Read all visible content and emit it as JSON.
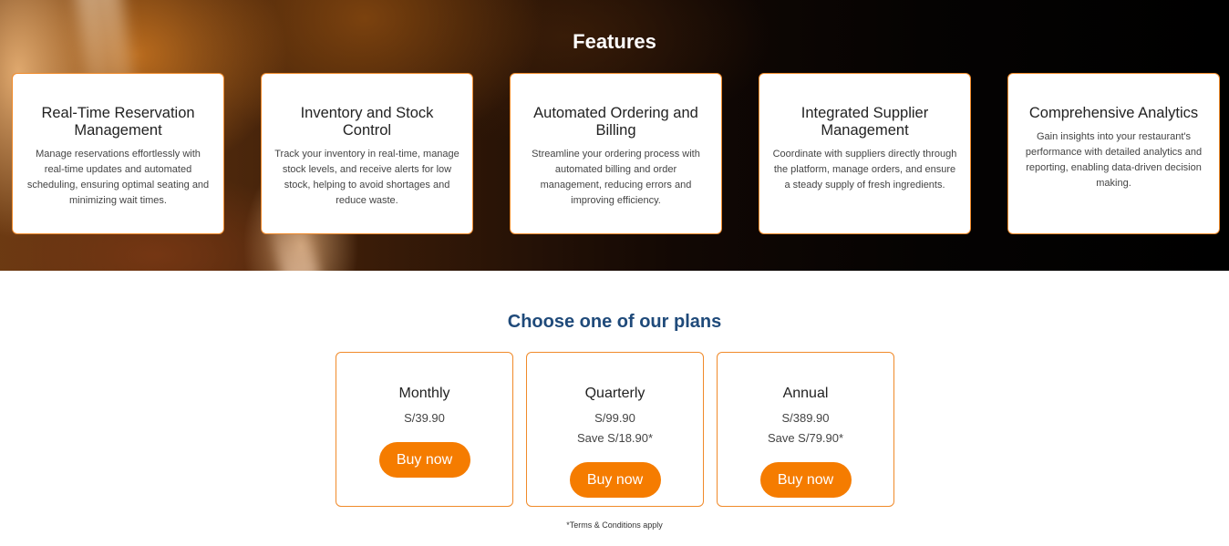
{
  "features": {
    "title": "Features",
    "cards": [
      {
        "title": "Real-Time Reservation Management",
        "description": "Manage reservations effortlessly with real-time updates and automated scheduling, ensuring optimal seating and minimizing wait times."
      },
      {
        "title": "Inventory and Stock Control",
        "description": "Track your inventory in real-time, manage stock levels, and receive alerts for low stock, helping to avoid shortages and reduce waste."
      },
      {
        "title": "Automated Ordering and Billing",
        "description": "Streamline your ordering process with automated billing and order management, reducing errors and improving efficiency."
      },
      {
        "title": "Integrated Supplier Management",
        "description": "Coordinate with suppliers directly through the platform, manage orders, and ensure a steady supply of fresh ingredients."
      },
      {
        "title": "Comprehensive Analytics",
        "description": "Gain insights into your restaurant's performance with detailed analytics and reporting, enabling data-driven decision making."
      }
    ]
  },
  "plans": {
    "title": "Choose one of our plans",
    "items": [
      {
        "name": "Monthly",
        "price": "S/39.90",
        "save": "",
        "button": "Buy now"
      },
      {
        "name": "Quarterly",
        "price": "S/99.90",
        "save": "Save S/18.90*",
        "button": "Buy now"
      },
      {
        "name": "Annual",
        "price": "S/389.90",
        "save": "Save S/79.90*",
        "button": "Buy now"
      }
    ],
    "terms": "*Terms & Conditions apply"
  },
  "colors": {
    "accent": "#f57c00",
    "card_border": "#f08a2a",
    "plans_title": "#1f4a7a"
  }
}
